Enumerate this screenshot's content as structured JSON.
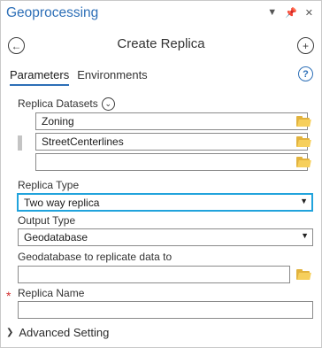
{
  "pane": {
    "title": "Geoprocessing"
  },
  "tool": {
    "title": "Create Replica"
  },
  "tabs": [
    {
      "label": "Parameters"
    },
    {
      "label": "Environments"
    }
  ],
  "help": {
    "glyph": "?"
  },
  "replica_datasets": {
    "label": "Replica Datasets",
    "items": [
      {
        "value": "Zoning"
      },
      {
        "value": "StreetCenterlines"
      },
      {
        "value": ""
      }
    ]
  },
  "replica_type": {
    "label": "Replica Type",
    "value": "Two way replica"
  },
  "output_type": {
    "label": "Output Type",
    "value": "Geodatabase"
  },
  "geodatabase": {
    "label": "Geodatabase to replicate data to",
    "value": ""
  },
  "replica_name": {
    "label": "Replica Name",
    "value": "",
    "required_mark": "*"
  },
  "advanced": {
    "label": "Advanced Setting"
  },
  "colors": {
    "accent": "#2d6fb7",
    "highlight": "#21a3dc",
    "folder": "#e2b33e",
    "required": "#d32f2f"
  }
}
